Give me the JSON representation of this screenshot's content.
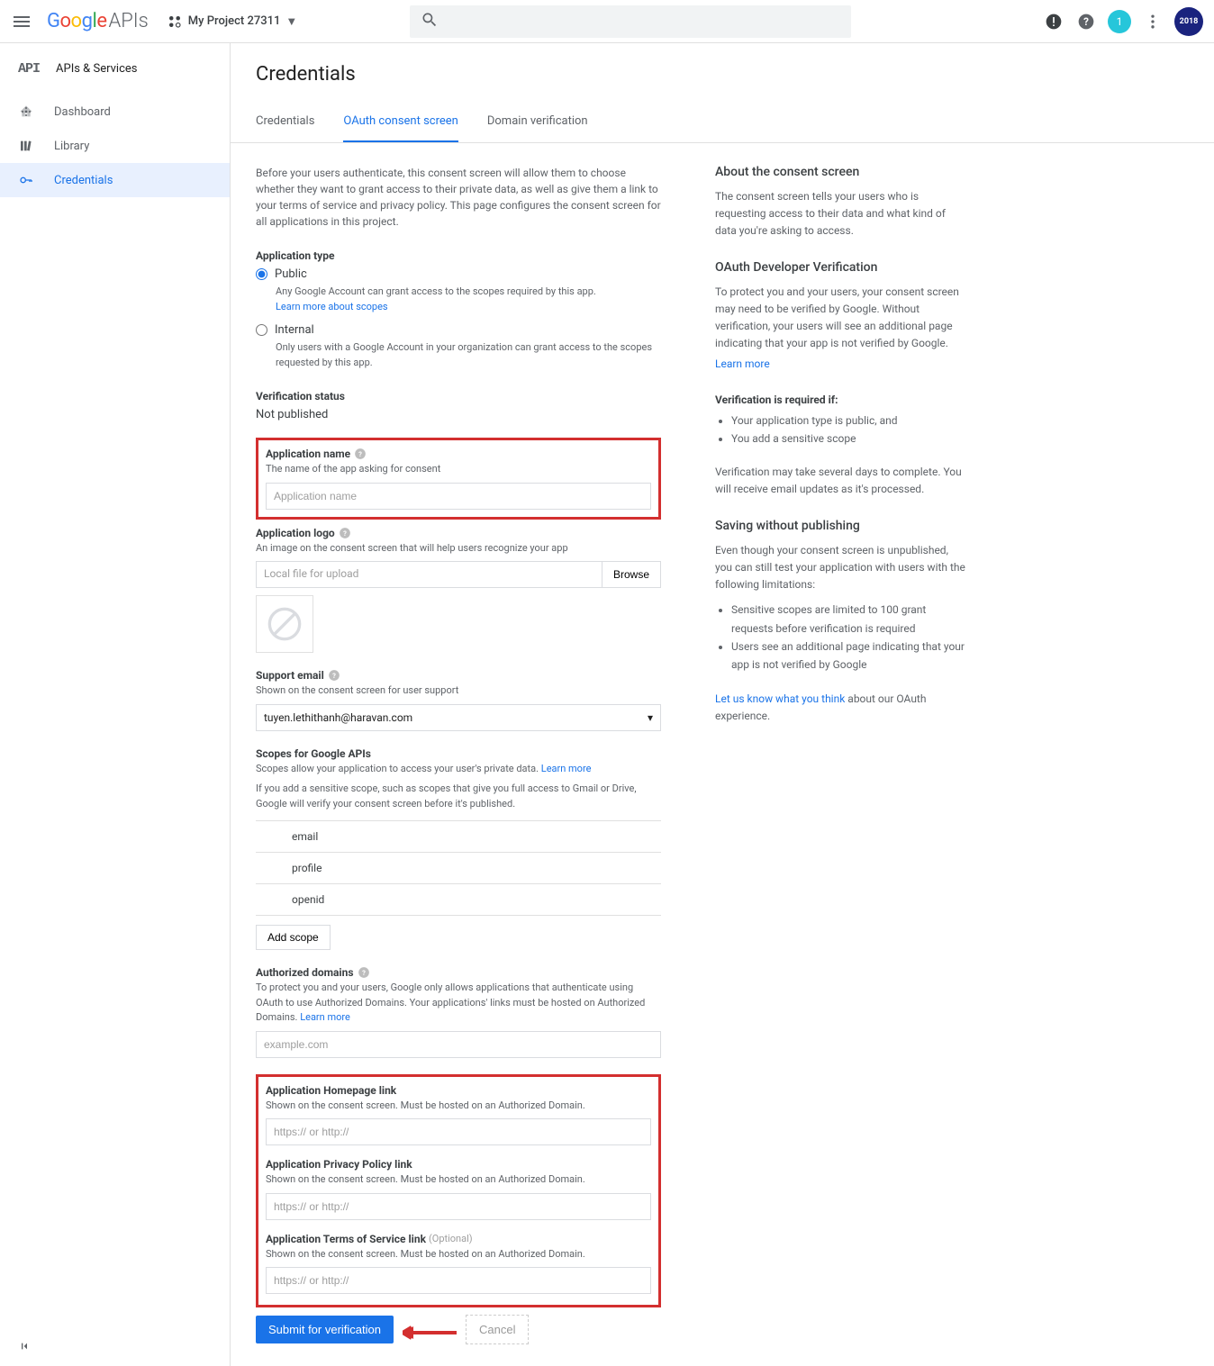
{
  "header": {
    "logo_apis": "APIs",
    "project_name": "My Project 27311",
    "avatar_badge": "1",
    "avatar_user": "2018"
  },
  "sidebar": {
    "title_icon": "API",
    "title": "APIs & Services",
    "items": [
      {
        "label": "Dashboard"
      },
      {
        "label": "Library"
      },
      {
        "label": "Credentials"
      }
    ]
  },
  "page": {
    "title": "Credentials",
    "tabs": [
      {
        "label": "Credentials"
      },
      {
        "label": "OAuth consent screen"
      },
      {
        "label": "Domain verification"
      }
    ]
  },
  "form": {
    "intro": "Before your users authenticate, this consent screen will allow them to choose whether they want to grant access to their private data, as well as give them a link to your terms of service and privacy policy. This page configures the consent screen for all applications in this project.",
    "app_type_label": "Application type",
    "radio_public": "Public",
    "radio_public_desc": "Any Google Account can grant access to the scopes required by this app.",
    "learn_more_scopes": "Learn more about scopes",
    "radio_internal": "Internal",
    "radio_internal_desc": "Only users with a Google Account in your organization can grant access to the scopes requested by this app.",
    "verif_status_label": "Verification status",
    "verif_status_value": "Not published",
    "app_name_label": "Application name",
    "app_name_desc": "The name of the app asking for consent",
    "app_name_placeholder": "Application name",
    "app_logo_label": "Application logo",
    "app_logo_desc": "An image on the consent screen that will help users recognize your app",
    "file_placeholder": "Local file for upload",
    "browse": "Browse",
    "support_email_label": "Support email",
    "support_email_desc": "Shown on the consent screen for user support",
    "support_email_value": "tuyen.lethithanh@haravan.com",
    "scopes_label": "Scopes for Google APIs",
    "scopes_desc1": "Scopes allow your application to access your user's private data. ",
    "scopes_learn_more": "Learn more",
    "scopes_desc2": "If you add a sensitive scope, such as scopes that give you full access to Gmail or Drive, Google will verify your consent screen before it's published.",
    "scopes": [
      "email",
      "profile",
      "openid"
    ],
    "add_scope": "Add scope",
    "auth_domains_label": "Authorized domains",
    "auth_domains_desc": "To protect you and your users, Google only allows applications that authenticate using OAuth to use Authorized Domains. Your applications' links must be hosted on Authorized Domains. ",
    "auth_domains_learn_more": "Learn more",
    "auth_domains_placeholder": "example.com",
    "homepage_label": "Application Homepage link",
    "homepage_desc": "Shown on the consent screen. Must be hosted on an Authorized Domain.",
    "url_placeholder": "https:// or http://",
    "privacy_label": "Application Privacy Policy link",
    "privacy_desc": "Shown on the consent screen. Must be hosted on an Authorized Domain.",
    "tos_label": "Application Terms of Service link",
    "tos_optional": "(Optional)",
    "tos_desc": "Shown on the consent screen. Must be hosted on an Authorized Domain.",
    "submit": "Submit for verification",
    "cancel": "Cancel"
  },
  "info": {
    "about_h": "About the consent screen",
    "about_p": "The consent screen tells your users who is requesting access to their data and what kind of data you're asking to access.",
    "verif_h": "OAuth Developer Verification",
    "verif_p": "To protect you and your users, your consent screen may need to be verified by Google. Without verification, your users will see an additional page indicating that your app is not verified by Google.",
    "verif_learn_more": "Learn more",
    "req_h": "Verification is required if:",
    "req_items": [
      "Your application type is public, and",
      "You add a sensitive scope"
    ],
    "req_p": "Verification may take several days to complete. You will receive email updates as it's processed.",
    "saving_h": "Saving without publishing",
    "saving_p": "Even though your consent screen is unpublished, you can still test your application with users with the following limitations:",
    "saving_items": [
      "Sensitive scopes are limited to 100 grant requests before verification is required",
      "Users see an additional page indicating that your app is not verified by Google"
    ],
    "feedback_link": "Let us know what you think",
    "feedback_rest": " about our OAuth experience."
  }
}
